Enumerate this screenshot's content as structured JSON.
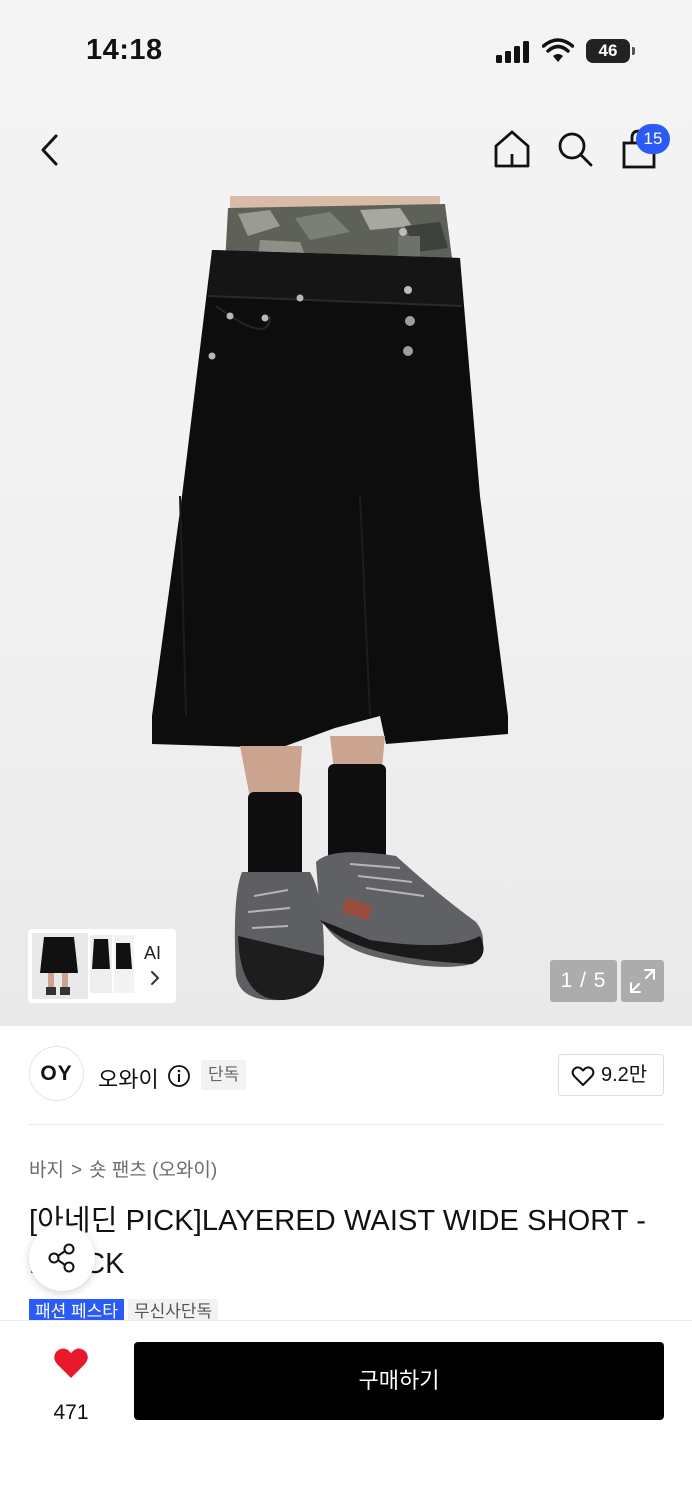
{
  "status_bar": {
    "time": "14:18",
    "battery": "46"
  },
  "nav": {
    "back_icon": "chevron-left-icon",
    "home_icon": "home-icon",
    "search_icon": "search-icon",
    "cart_icon": "shopping-bag-icon",
    "cart_count": "15",
    "badge_color": "#2a5bf6"
  },
  "gallery": {
    "thumb_ai_label": "AI",
    "counter": "1 / 5",
    "expand_icon": "expand-icon"
  },
  "brand": {
    "logo_text": "OY",
    "name": "오와이",
    "info_icon": "info-icon",
    "exclusive_tag": "단독",
    "likes": "9.2만"
  },
  "product": {
    "breadcrumb": [
      "바지",
      "숏 팬츠 (오와이)"
    ],
    "title": "[아네딘 PICK]LAYERED WAIST WIDE SHORT - BLACK",
    "tags": [
      "패션 페스타",
      "무신사단독"
    ]
  },
  "bottom": {
    "heart_color": "#e8192c",
    "wish_count": "471",
    "buy_label": "구매하기"
  }
}
